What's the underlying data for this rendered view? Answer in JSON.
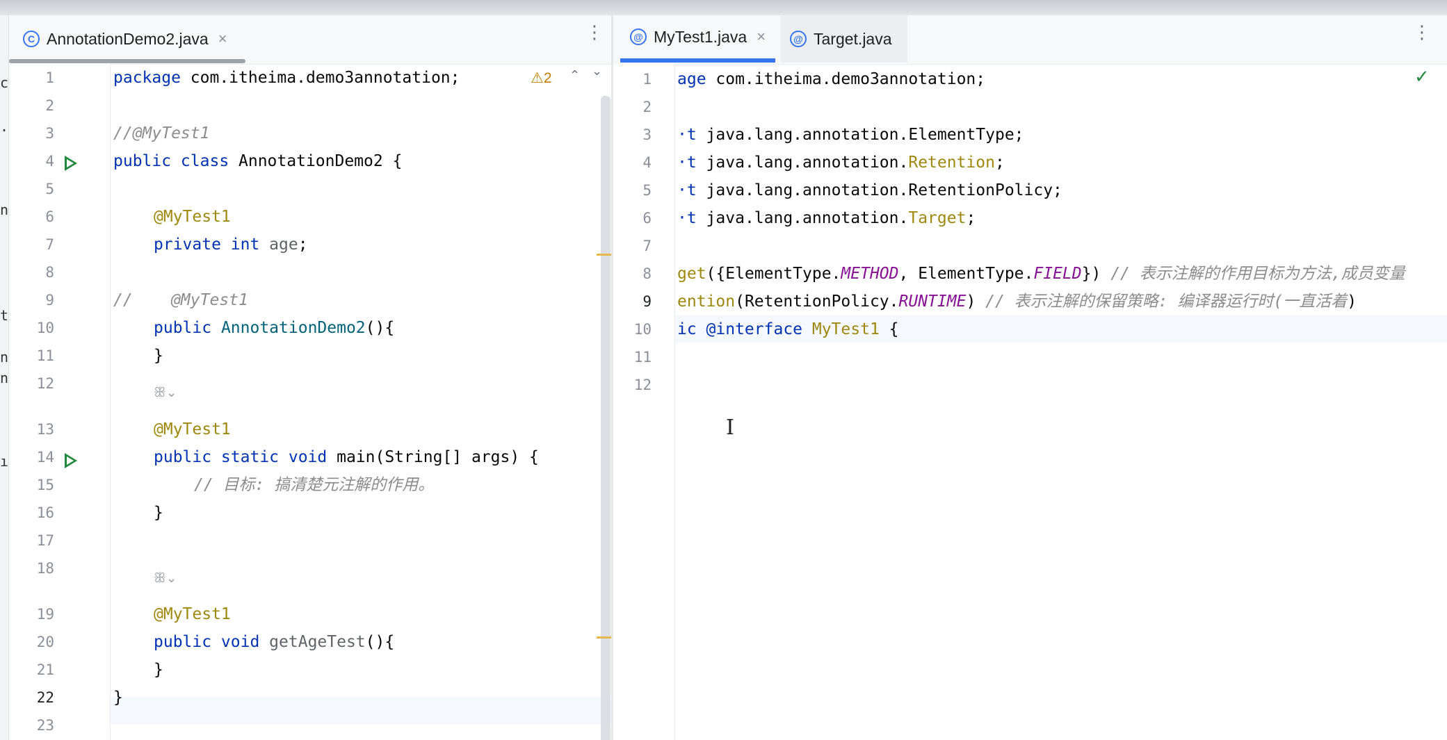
{
  "left_tab": {
    "title": "AnnotationDemo2.java",
    "close": "×",
    "icon": "C"
  },
  "right_tabs": [
    {
      "title": "MyTest1.java",
      "close": "×",
      "icon": "@"
    },
    {
      "title": "Target.java",
      "icon": "@"
    }
  ],
  "menu_glyph": "⋮",
  "warning": {
    "icon": "⚠",
    "count": "2"
  },
  "nav": {
    "up": "⌃",
    "down": "⌄"
  },
  "check_mark": "✓",
  "hint_glyph": "ꕥ⌄",
  "left_edge_chars": [
    "c",
    ".",
    "n",
    "ti",
    "nl",
    "nl",
    "ır"
  ],
  "left_code": {
    "line_numbers": [
      "1",
      "2",
      "3",
      "4",
      "5",
      "6",
      "7",
      "8",
      "9",
      "10",
      "11",
      "12",
      "13",
      "14",
      "15",
      "16",
      "17",
      "18",
      "19",
      "20",
      "21",
      "22",
      "23"
    ],
    "l1_kw": "package",
    "l1_rest": " com.itheima.demo3annotation;",
    "l3": "//@MyTest1",
    "l4_kw": "public class",
    "l4_rest": " AnnotationDemo2 {",
    "l6": "@MyTest1",
    "l7_kw": "private int",
    "l7_var": " age",
    "l7_end": ";",
    "l9": "//    @MyTest1",
    "l10_kw": "public",
    "l10_fn": " AnnotationDemo2",
    "l10_end": "(){",
    "l11": "}",
    "l13": "@MyTest1",
    "l14_kw": "public static void",
    "l14_rest": " main(String[] args) {",
    "l15": "// 目标: 搞清楚元注解的作用。",
    "l16": "}",
    "l19": "@MyTest1",
    "l20_kw": "public void",
    "l20_var": " getAgeTest",
    "l20_end": "(){",
    "l21": "}",
    "l22": "}"
  },
  "right_code": {
    "line_numbers": [
      "1",
      "2",
      "3",
      "4",
      "5",
      "6",
      "7",
      "8",
      "9",
      "10",
      "11",
      "12"
    ],
    "l1_kw": "age",
    "l1_rest": " com.itheima.demo3annotation;",
    "l3_kw": "·t",
    "l3_rest": " java.lang.annotation.ElementType;",
    "l4_kw": "·t",
    "l4_pre": " java.lang.annotation.",
    "l4_ann": "Retention",
    "l4_end": ";",
    "l5_kw": "·t",
    "l5_rest": " java.lang.annotation.RetentionPolicy;",
    "l6_kw": "·t",
    "l6_pre": " java.lang.annotation.",
    "l6_ann": "Target",
    "l6_end": ";",
    "l8_ann": "get",
    "l8_a": "({ElementType.",
    "l8_f1": "METHOD",
    "l8_b": ", ElementType.",
    "l8_f2": "FIELD",
    "l8_c": "}) ",
    "l8_cmt": "// 表示注解的作用目标为方法,成员变量",
    "l9_ann": "ention",
    "l9_a": "(RetentionPolicy.",
    "l9_f": "RUNTIME",
    "l9_b": ") ",
    "l9_cmt": "// 表示注解的保留策略: 编译器运行时(一直活着",
    "l9_end": ")",
    "l10_kw": "ic @interface",
    "l10_ann": " MyTest1",
    "l10_end": " {"
  },
  "cursor_glyph": "I"
}
